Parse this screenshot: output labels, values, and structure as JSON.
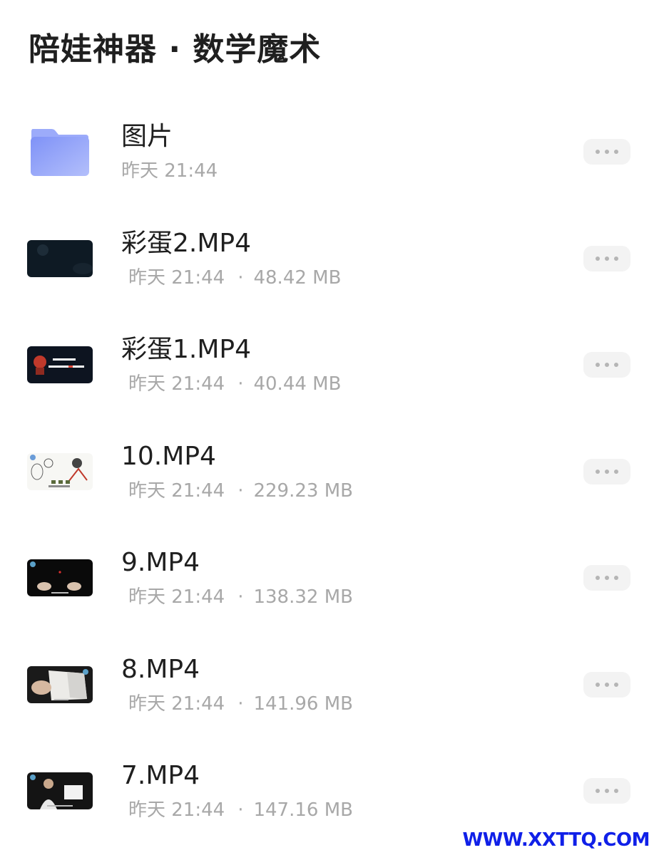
{
  "header": {
    "title": "陪娃神器 · 数学魔术"
  },
  "files": [
    {
      "kind": "folder",
      "icon": "folder-icon",
      "name": "图片",
      "meta": "昨天 21:44"
    },
    {
      "kind": "video",
      "icon": "video-thumbnail",
      "name": "彩蛋2.MP4",
      "time": "昨天 21:44",
      "separator": "·",
      "size": "48.42 MB"
    },
    {
      "kind": "video",
      "icon": "video-thumbnail",
      "name": "彩蛋1.MP4",
      "time": "昨天 21:44",
      "separator": "·",
      "size": "40.44 MB"
    },
    {
      "kind": "video",
      "icon": "video-thumbnail",
      "name": "10.MP4",
      "time": "昨天 21:44",
      "separator": "·",
      "size": "229.23 MB"
    },
    {
      "kind": "video",
      "icon": "video-thumbnail",
      "name": "9.MP4",
      "time": "昨天 21:44",
      "separator": "·",
      "size": "138.32 MB"
    },
    {
      "kind": "video",
      "icon": "video-thumbnail",
      "name": "8.MP4",
      "time": "昨天 21:44",
      "separator": "·",
      "size": "141.96 MB"
    },
    {
      "kind": "video",
      "icon": "video-thumbnail",
      "name": "7.MP4",
      "time": "昨天 21:44",
      "separator": "·",
      "size": "147.16 MB"
    }
  ],
  "more_button": {
    "icon": "more-dots-icon"
  },
  "watermark": "WWW.XXTTQ.COM",
  "colors": {
    "folder_gradient_start": "#8fa0f8",
    "folder_gradient_end": "#a9b6fb",
    "secondary_text": "#a8a8a8",
    "watermark": "#1020e8"
  }
}
